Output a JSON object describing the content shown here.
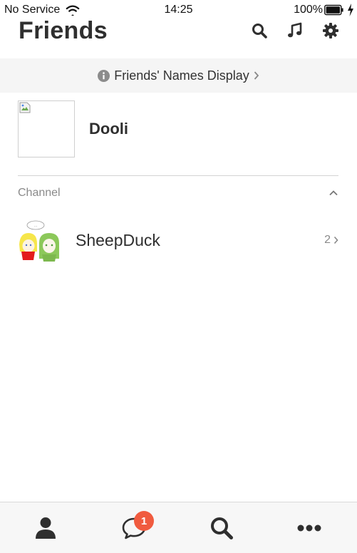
{
  "status_bar": {
    "carrier": "No Service",
    "time": "14:25",
    "battery": "100%"
  },
  "header": {
    "title": "Friends",
    "icons": [
      "search-icon",
      "music-note-icon",
      "gear-icon"
    ]
  },
  "banner": {
    "label": "Friends' Names Display",
    "icon": "info-icon"
  },
  "profile": {
    "name": "Dooli"
  },
  "channel_section": {
    "label": "Channel",
    "items": [
      {
        "name": "SheepDuck",
        "count": "2"
      }
    ]
  },
  "tabbar": {
    "tabs": [
      {
        "icon": "person-icon"
      },
      {
        "icon": "chat-bubble-icon",
        "badge": "1"
      },
      {
        "icon": "search-icon"
      },
      {
        "icon": "more-icon"
      }
    ]
  },
  "colors": {
    "badge": "#f05b3f",
    "banner_bg": "#f5f5f5",
    "icon_dark": "#2f2f2f"
  }
}
